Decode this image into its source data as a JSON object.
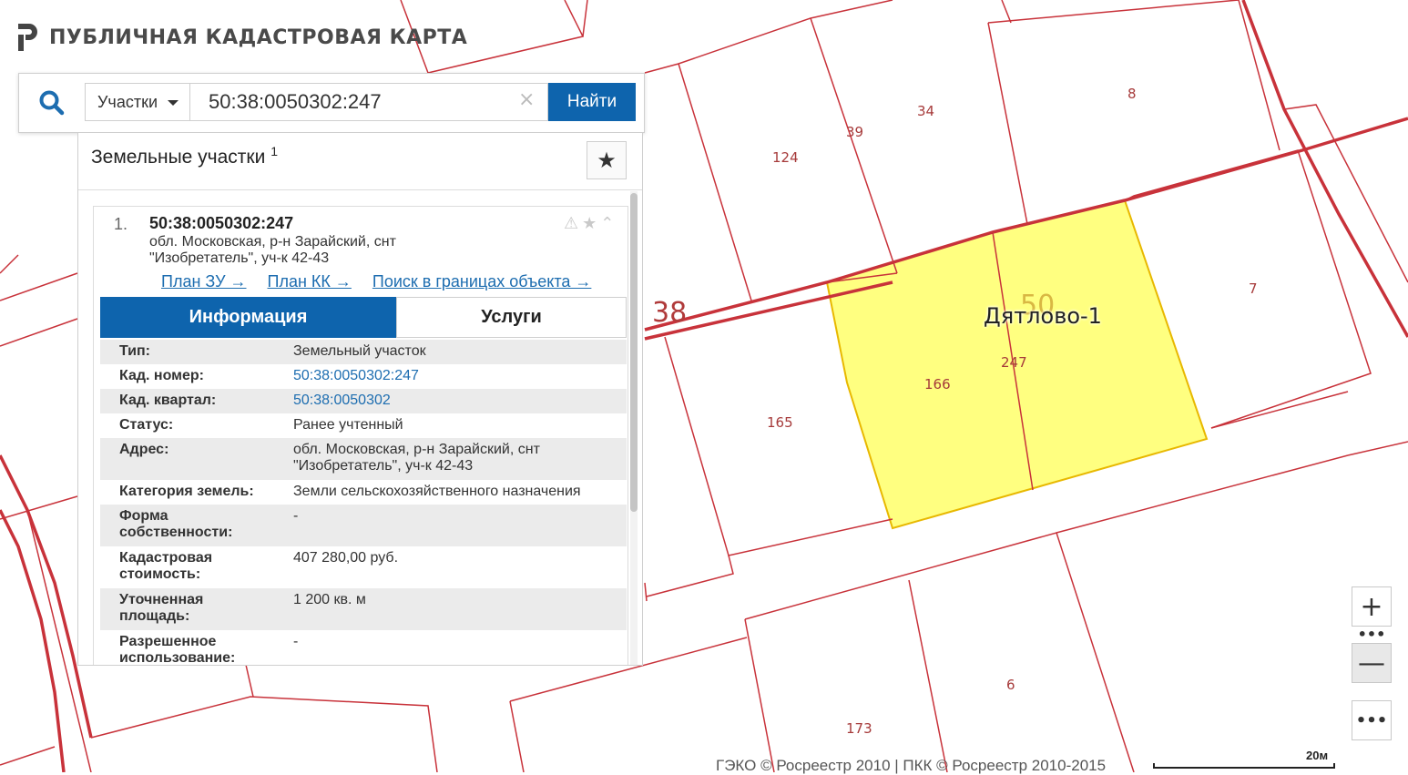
{
  "app": {
    "title": "ПУБЛИЧНАЯ КАДАСТРОВАЯ КАРТА",
    "logo_icon": "rosreestr-logo-icon"
  },
  "search": {
    "icon": "search-icon",
    "type_selected": "Участки",
    "query": "50:38:0050302:247",
    "clear_icon": "close-icon",
    "clear_glyph": "×",
    "submit_label": "Найти"
  },
  "panel": {
    "title": "Земельные участки",
    "count": "1",
    "favorite_icon": "star-icon",
    "favorite_glyph": "★"
  },
  "result": {
    "number": "1.",
    "cadastral_number": "50:38:0050302:247",
    "address_line1": "обл. Московская, р-н Зарайский, снт",
    "address_line2": "\"Изобретатель\", уч-к 42-43",
    "action_icons": "⚠★⌃",
    "links": {
      "plan_zu": "План ЗУ →",
      "plan_kk": "План КК →",
      "search_bounds": "Поиск в границах объекта →"
    },
    "tabs": {
      "info": "Информация",
      "services": "Услуги"
    },
    "attributes": [
      {
        "key": "Тип:",
        "value": "Земельный участок"
      },
      {
        "key": "Кад. номер:",
        "value": "50:38:0050302:247"
      },
      {
        "key": "Кад. квартал:",
        "value": "50:38:0050302"
      },
      {
        "key": "Статус:",
        "value": "Ранее учтенный"
      },
      {
        "key_line1": "Адрес:",
        "value_line1": "обл. Московская, р-н Зарайский, снт",
        "value_line2": "\"Изобретатель\", уч-к 42-43"
      },
      {
        "key": "Категория земель:",
        "value": "Земли сельскохозяйственного назначения"
      },
      {
        "key_line1": "Форма",
        "key_line2": "собственности:",
        "value": "-"
      },
      {
        "key_line1": "Кадастровая",
        "key_line2": "стоимость:",
        "value": "407 280,00 руб."
      },
      {
        "key_line1": "Уточненная",
        "key_line2": "площадь:",
        "value": "1 200 кв. м"
      },
      {
        "key_line1": "Разрешенное",
        "key_line2": "использование:",
        "value": "-"
      }
    ]
  },
  "map": {
    "settlement_name": "Дятлово-1",
    "quarter_label": "38",
    "quarter_label_faded": "50",
    "highlight_color": "#ffff80",
    "boundary_color": "#c8323a",
    "plot_labels": [
      "124",
      "39",
      "34",
      "8",
      "7",
      "166",
      "247",
      "165",
      "6",
      "173"
    ]
  },
  "controls": {
    "zoom_in_glyph": "+",
    "zoom_out_glyph": "—",
    "dots_glyph": "•••",
    "more_glyph": "•••",
    "zoom_in_icon": "plus-icon",
    "zoom_out_icon": "minus-icon",
    "more_icon": "more-icon"
  },
  "footer": {
    "attribution": "ГЭКО © Росреестр 2010 | ПКК © Росреестр 2010-2015",
    "scale_label": "20м"
  }
}
